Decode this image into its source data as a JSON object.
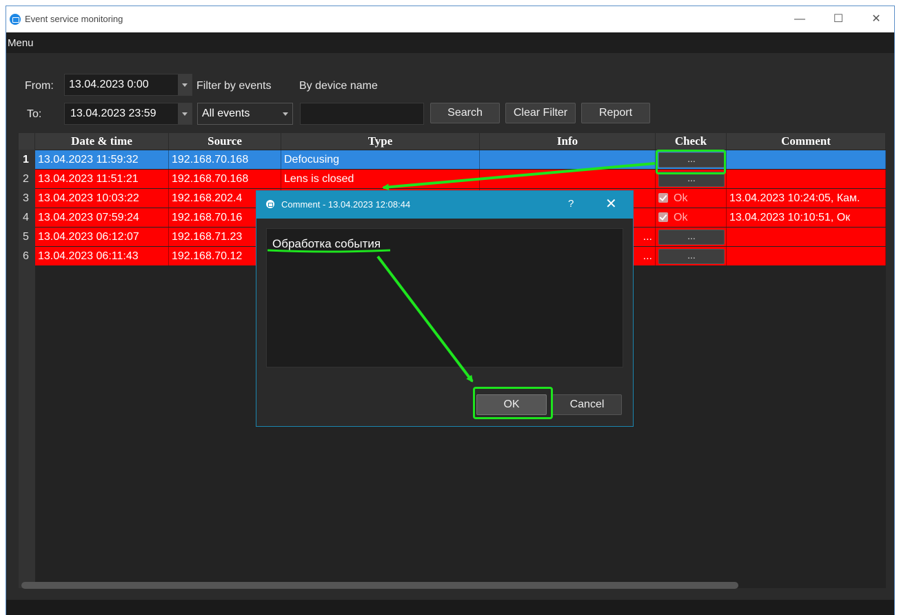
{
  "window": {
    "title": "Event service monitoring",
    "controls": [
      "—",
      "☐",
      "✕"
    ]
  },
  "menu": {
    "label": "Menu"
  },
  "filters": {
    "from_label": "From:",
    "from_value": "13.04.2023 0:00",
    "to_label": "To:",
    "to_value": "13.04.2023 23:59",
    "filter_events_label": "Filter by events",
    "events_selected": "All events",
    "device_name_label": "By device name",
    "device_name_value": "",
    "search_label": "Search",
    "clear_label": "Clear Filter",
    "report_label": "Report"
  },
  "table": {
    "columns": [
      "Date & time",
      "Source",
      "Type",
      "Info",
      "Check",
      "Comment"
    ],
    "rows": [
      {
        "n": "1",
        "datetime": "13.04.2023 11:59:32",
        "source": "192.168.70.168",
        "type": "Defocusing",
        "info": "",
        "check": "...",
        "comment": ""
      },
      {
        "n": "2",
        "datetime": "13.04.2023 11:51:21",
        "source": "192.168.70.168",
        "type": "Lens is closed",
        "info": "",
        "check": "...",
        "comment": ""
      },
      {
        "n": "3",
        "datetime": "13.04.2023 10:03:22",
        "source": "192.168.202.4",
        "type": "",
        "info": "",
        "check": "Ok",
        "comment": "13.04.2023 10:24:05, Кам."
      },
      {
        "n": "4",
        "datetime": "13.04.2023 07:59:24",
        "source": "192.168.70.16",
        "type": "",
        "info": "",
        "check": "Ok",
        "comment": "13.04.2023 10:10:51, Ок"
      },
      {
        "n": "5",
        "datetime": "13.04.2023 06:12:07",
        "source": "192.168.71.23",
        "type": "",
        "info": "...",
        "check": "...",
        "comment": ""
      },
      {
        "n": "6",
        "datetime": "13.04.2023 06:11:43",
        "source": "192.168.70.12",
        "type": "",
        "info": "...",
        "check": "...",
        "comment": ""
      }
    ]
  },
  "dialog": {
    "title": "Comment - 13.04.2023 12:08:44",
    "help": "?",
    "close": "✕",
    "text": "Обработка события",
    "ok_label": "OK",
    "cancel_label": "Cancel"
  },
  "colors": {
    "selected_row": "#2f88e0",
    "alarm_row": "#ff0000",
    "highlight": "#1ee41e",
    "dialog_title": "#1a90bc"
  }
}
